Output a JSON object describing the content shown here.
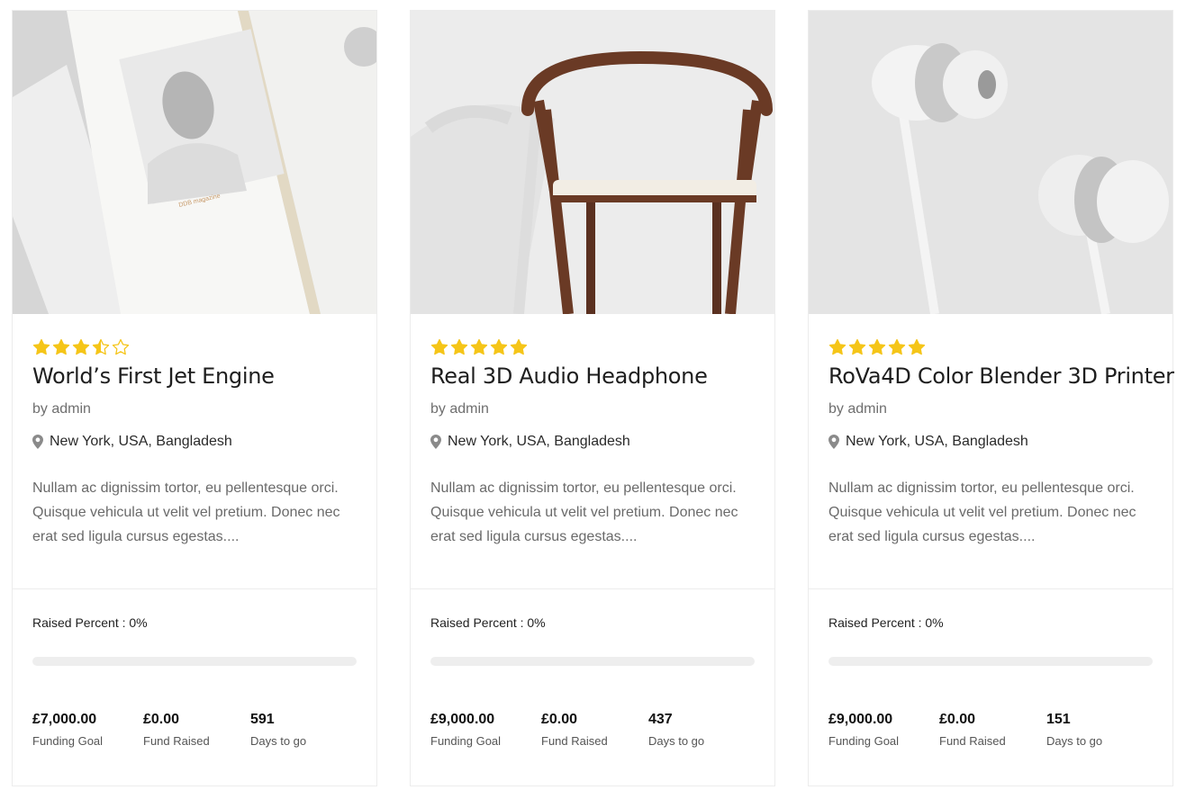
{
  "campaigns": [
    {
      "image_name": "magazine-image",
      "rating": 3.5,
      "title": "World’s First Jet Engine",
      "byline": "by admin",
      "location": "New York, USA, Bangladesh",
      "excerpt": "Nullam ac dignissim tortor, eu pellentesque orci. Quisque vehicula ut velit vel pretium. Donec nec erat sed ligula cursus egestas....",
      "raised_label": "Raised Percent : 0%",
      "raised_percent": 0,
      "stats": [
        {
          "value": "£7,000.00",
          "label": "Funding Goal"
        },
        {
          "value": "£0.00",
          "label": "Fund Raised"
        },
        {
          "value": "591",
          "label": "Days to go"
        }
      ]
    },
    {
      "image_name": "chair-image",
      "rating": 5,
      "title": "Real 3D Audio Headphone",
      "byline": "by admin",
      "location": "New York, USA, Bangladesh",
      "excerpt": "Nullam ac dignissim tortor, eu pellentesque orci. Quisque vehicula ut velit vel pretium. Donec nec erat sed ligula cursus egestas....",
      "raised_label": "Raised Percent : 0%",
      "raised_percent": 0,
      "stats": [
        {
          "value": "£9,000.00",
          "label": "Funding Goal"
        },
        {
          "value": "£0.00",
          "label": "Fund Raised"
        },
        {
          "value": "437",
          "label": "Days to go"
        }
      ]
    },
    {
      "image_name": "earphones-image",
      "rating": 5,
      "title": "RoVa4D Color Blender 3D Printer",
      "byline": "by admin",
      "location": "New York, USA, Bangladesh",
      "excerpt": "Nullam ac dignissim tortor, eu pellentesque orci. Quisque vehicula ut velit vel pretium. Donec nec erat sed ligula cursus egestas....",
      "raised_label": "Raised Percent : 0%",
      "raised_percent": 0,
      "stats": [
        {
          "value": "£9,000.00",
          "label": "Funding Goal"
        },
        {
          "value": "£0.00",
          "label": "Fund Raised"
        },
        {
          "value": "151",
          "label": "Days to go"
        }
      ]
    }
  ],
  "colors": {
    "star": "#f5c518",
    "star_empty": "#f5c518",
    "progress_track": "#eeeeee"
  },
  "icons": {
    "rating": "star-icon",
    "location": "map-pin-icon"
  }
}
